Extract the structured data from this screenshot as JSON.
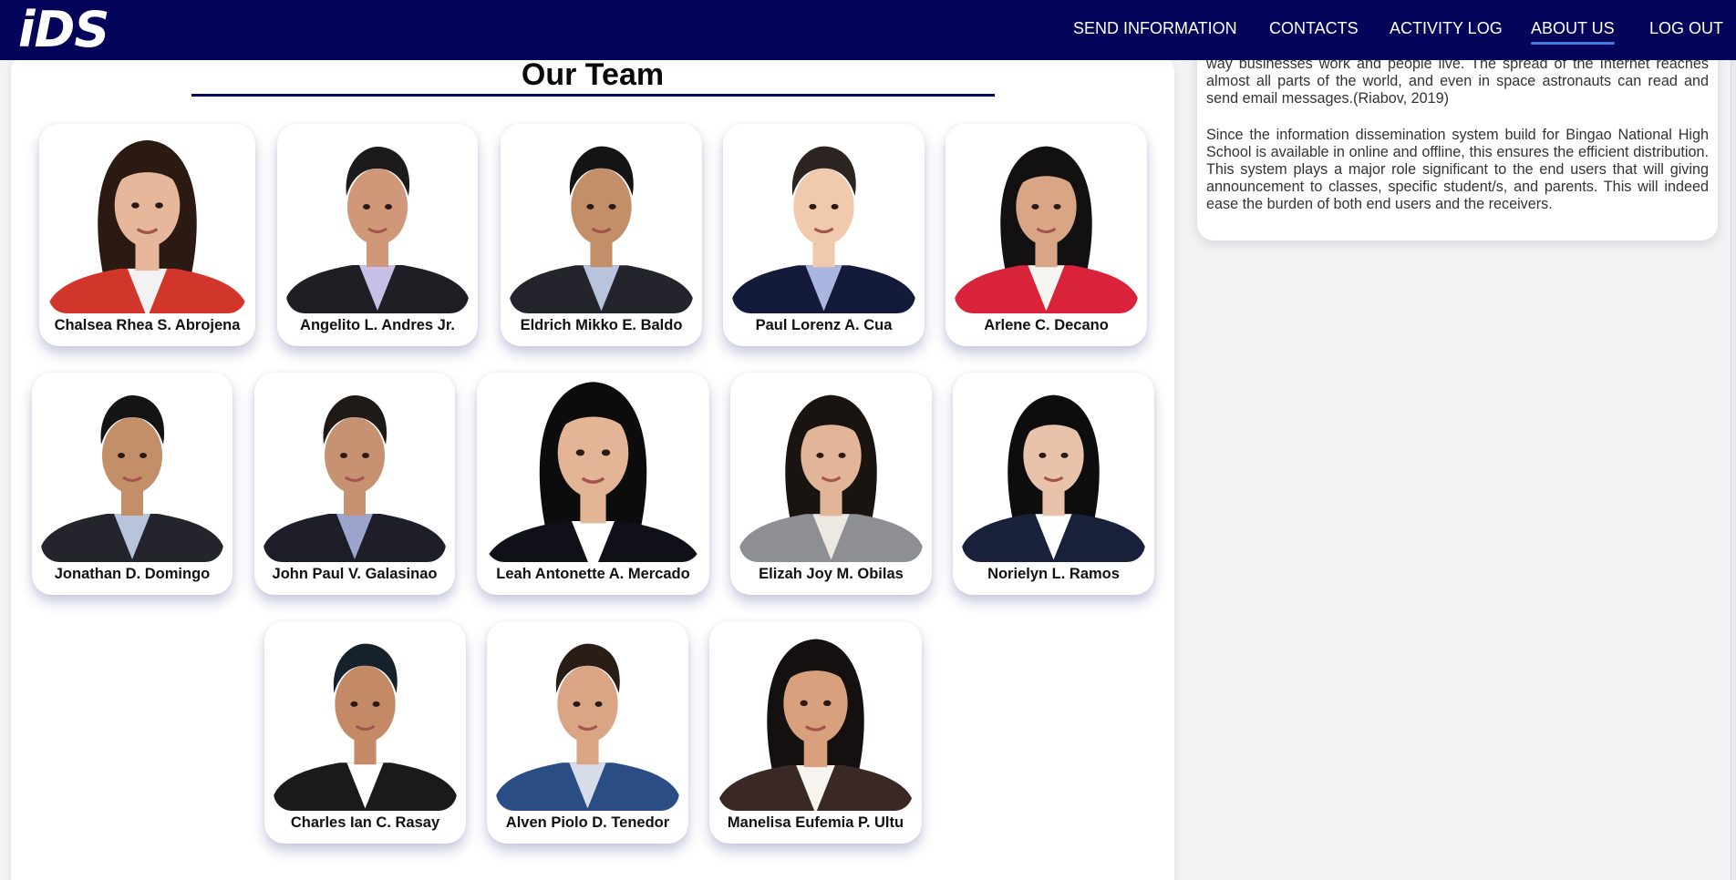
{
  "nav": {
    "logo": "iDS",
    "links": [
      "SEND INFORMATION",
      "CONTACTS",
      "ACTIVITY LOG",
      "ABOUT US",
      "LOG OUT"
    ],
    "active": "ABOUT US"
  },
  "about": {
    "paragraph1": "way businesses work and people live. The spread of the Internet reaches almost all parts of the world, and even in space astronauts can read and send email messages.(Riabov, 2019)",
    "paragraph2": "Since the information dissemination system build for Bingao National High School is available in online and offline, this ensures the efficient distribution. This system plays a major role significant to the end users that will giving announcement to classes, specific student/s, and parents. This will indeed ease the burden of both end users and the receivers."
  },
  "team": {
    "title": "Our Team",
    "members": [
      {
        "name": "Chalsea Rhea S. Abrojena",
        "photo": "female-long-hair-red-blazer-photo"
      },
      {
        "name": "Angelito L. Andres Jr.",
        "photo": "male-suit-purple-shirt-photo"
      },
      {
        "name": "Eldrich Mikko E. Baldo",
        "photo": "male-suit-tie-photo"
      },
      {
        "name": "Paul Lorenz A. Cua",
        "photo": "male-navy-jacket-photo"
      },
      {
        "name": "Arlene C. Decano",
        "photo": "female-red-blazer-photo"
      },
      {
        "name": "Jonathan D. Domingo",
        "photo": "male-suit-tie-photo"
      },
      {
        "name": "John Paul V. Galasinao",
        "photo": "male-suit-purple-tie-photo"
      },
      {
        "name": "Leah Antonette A. Mercado",
        "photo": "female-black-blazer-photo"
      },
      {
        "name": "Elizah Joy M. Obilas",
        "photo": "female-gray-cardigan-photo"
      },
      {
        "name": "Norielyn L. Ramos",
        "photo": "female-navy-blazer-photo"
      },
      {
        "name": "Charles Ian C. Rasay",
        "photo": "male-black-suit-photo"
      },
      {
        "name": "Alven Piolo D. Tenedor",
        "photo": "male-blue-suit-photo"
      },
      {
        "name": "Manelisa Eufemia P. Ultu",
        "photo": "female-white-blouse-photo"
      }
    ]
  },
  "colors": {
    "nav_bg": "#04045a",
    "active_underline": "#3f7fe0"
  }
}
